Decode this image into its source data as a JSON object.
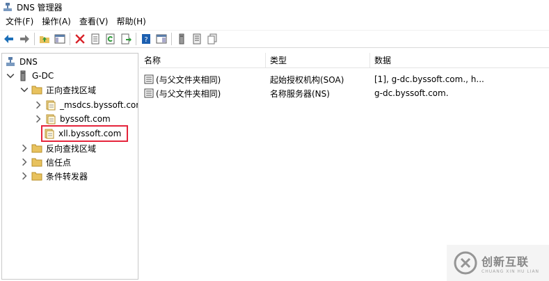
{
  "window": {
    "title": "DNS 管理器"
  },
  "menu": [
    {
      "label": "文件(F)"
    },
    {
      "label": "操作(A)"
    },
    {
      "label": "查看(V)"
    },
    {
      "label": "帮助(H)"
    }
  ],
  "toolbar_icons": [
    "back-arrow-icon",
    "forward-arrow-icon",
    "up-folder-icon",
    "show-hide-tree-icon",
    "delete-icon",
    "properties-icon",
    "refresh-icon",
    "export-list-icon",
    "help-icon",
    "show-pane-icon",
    "server-icon",
    "list-icon",
    "copy-icon"
  ],
  "tree": {
    "root": "DNS",
    "server": "G-DC",
    "forward_zones": "正向查找区域",
    "zone_msdcs": "_msdcs.byssoft.com",
    "zone_byssoft": "byssoft.com",
    "zone_xll": "xll.byssoft.com",
    "reverse_zones": "反向查找区域",
    "trust_points": "信任点",
    "conditional_forwarders": "条件转发器"
  },
  "list": {
    "columns": [
      "名称",
      "类型",
      "数据"
    ],
    "rows": [
      {
        "name": "(与父文件夹相同)",
        "type": "起始授权机构(SOA)",
        "data": "[1], g-dc.byssoft.com., h..."
      },
      {
        "name": "(与父文件夹相同)",
        "type": "名称服务器(NS)",
        "data": "g-dc.byssoft.com."
      }
    ]
  },
  "watermark": {
    "main": "创新互联",
    "sub": "CHUANG XIN HU LIAN"
  },
  "colors": {
    "highlight_box": "#e5243b",
    "folder": "#e8c25e",
    "accent": "#1c6fb8"
  }
}
